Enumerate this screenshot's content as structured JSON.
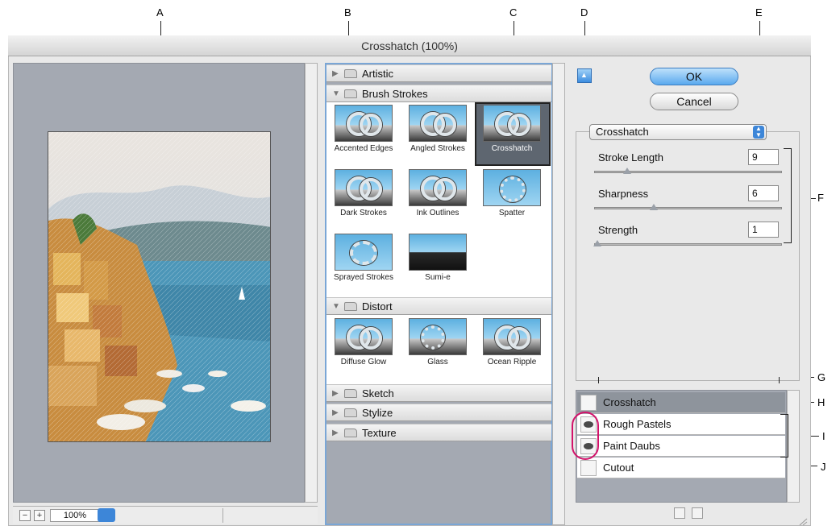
{
  "window": {
    "title": "Crosshatch (100%)"
  },
  "callouts": [
    "A",
    "B",
    "C",
    "D",
    "E",
    "F",
    "G",
    "H",
    "I",
    "J"
  ],
  "preview": {
    "zoom": "100%",
    "zoom_out": "−",
    "zoom_in": "+"
  },
  "gallery": {
    "categories": [
      {
        "label": "Artistic",
        "expanded": false
      },
      {
        "label": "Brush Strokes",
        "expanded": true,
        "filters": [
          "Accented Edges",
          "Angled Strokes",
          "Crosshatch",
          "Dark Strokes",
          "Ink Outlines",
          "Spatter",
          "Sprayed Strokes",
          "Sumi-e"
        ]
      },
      {
        "label": "Distort",
        "expanded": true,
        "filters": [
          "Diffuse Glow",
          "Glass",
          "Ocean Ripple"
        ]
      },
      {
        "label": "Sketch",
        "expanded": false
      },
      {
        "label": "Stylize",
        "expanded": false
      },
      {
        "label": "Texture",
        "expanded": false
      }
    ],
    "selected_filter": "Crosshatch"
  },
  "buttons": {
    "ok": "OK",
    "cancel": "Cancel"
  },
  "settings": {
    "filter_select": "Crosshatch",
    "params": [
      {
        "label": "Stroke Length",
        "value": "9",
        "level": 0.16
      },
      {
        "label": "Sharpness",
        "value": "6",
        "level": 0.3
      },
      {
        "label": "Strength",
        "value": "1",
        "level": 0.0
      }
    ]
  },
  "layers": [
    {
      "name": "Crosshatch",
      "visible": false,
      "selected": true
    },
    {
      "name": "Rough Pastels",
      "visible": true,
      "selected": false
    },
    {
      "name": "Paint Daubs",
      "visible": true,
      "selected": false
    },
    {
      "name": "Cutout",
      "visible": false,
      "selected": false
    }
  ],
  "colors": {
    "accent": "#3d86d8",
    "gallery_bg": "#a4a9b2",
    "highlight_ring": "#d2126a"
  }
}
